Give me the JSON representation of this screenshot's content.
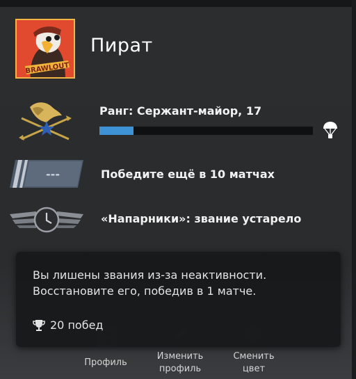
{
  "profile": {
    "nickname": "Пират",
    "avatar_icon": "eagle-pirate-avatar-icon",
    "avatar_badge_text": "BRAWLOUT"
  },
  "rank": {
    "label": "Ранг: Сержант-майор, 17",
    "progress_fraction": 0.16,
    "icon": "eagle-rank-badge-icon",
    "reward_icon": "parachute-icon"
  },
  "competitive": {
    "label": "Победите ещё в 10 матчах",
    "placeholder": "---"
  },
  "wingman": {
    "label": "«Напарники»: звание устарело",
    "icon": "expired-clock-badge-icon"
  },
  "bottom": {
    "profile_label": "Профиль",
    "edit_label_line1": "Изменить",
    "edit_label_line2": "профиль",
    "color_label_line1": "Сменить",
    "color_label_line2": "цвет"
  },
  "tooltip": {
    "line1": "Вы лишены звания из-за неактивности.",
    "line2": "Восстановите его, победив в 1 матче.",
    "wins": "20 побед",
    "wins_icon": "trophy-icon"
  },
  "colors": {
    "progress": "#3d93d6",
    "avatar_background": "#e0432e",
    "avatar_border": "#f3b545"
  }
}
